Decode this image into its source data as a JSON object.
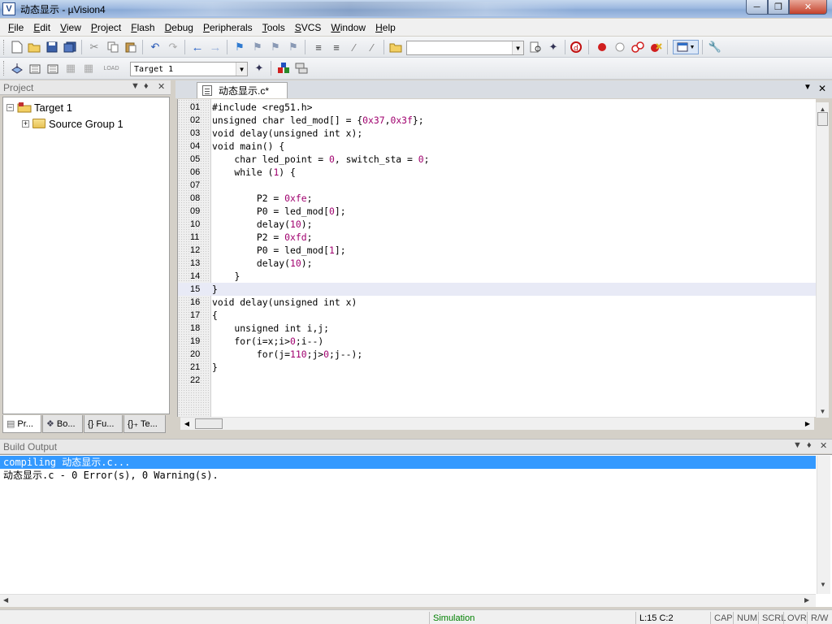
{
  "window": {
    "title": "动态显示 - µVision4",
    "app_icon": "V"
  },
  "menu": [
    "File",
    "Edit",
    "View",
    "Project",
    "Flash",
    "Debug",
    "Peripherals",
    "Tools",
    "SVCS",
    "Window",
    "Help"
  ],
  "toolbar2": {
    "target_value": "Target 1"
  },
  "project_panel": {
    "title": "Project",
    "tree": {
      "root": "Target 1",
      "child": "Source Group 1"
    },
    "tabs": [
      "Pr...",
      "Bo...",
      "{} Fu...",
      "{}₊ Te..."
    ]
  },
  "editor": {
    "tab_label": "动态显示.c*",
    "lines": [
      {
        "n": "01",
        "code": "#include <reg51.h>"
      },
      {
        "n": "02",
        "code": "unsigned char led_mod[] = {0x37,0x3f};"
      },
      {
        "n": "03",
        "code": "void delay(unsigned int x);"
      },
      {
        "n": "04",
        "code": "void main() {"
      },
      {
        "n": "05",
        "code": "    char led_point = 0, switch_sta = 0;"
      },
      {
        "n": "06",
        "code": "    while (1) {"
      },
      {
        "n": "07",
        "code": ""
      },
      {
        "n": "08",
        "code": "        P2 = 0xfe;"
      },
      {
        "n": "09",
        "code": "        P0 = led_mod[0];"
      },
      {
        "n": "10",
        "code": "        delay(10);"
      },
      {
        "n": "11",
        "code": "        P2 = 0xfd;"
      },
      {
        "n": "12",
        "code": "        P0 = led_mod[1];"
      },
      {
        "n": "13",
        "code": "        delay(10);"
      },
      {
        "n": "14",
        "code": "    }"
      },
      {
        "n": "15",
        "code": "}"
      },
      {
        "n": "16",
        "code": "void delay(unsigned int x)"
      },
      {
        "n": "17",
        "code": "{"
      },
      {
        "n": "18",
        "code": "    unsigned int i,j;"
      },
      {
        "n": "19",
        "code": "    for(i=x;i>0;i--)"
      },
      {
        "n": "20",
        "code": "        for(j=110;j>0;j--);"
      },
      {
        "n": "21",
        "code": "}"
      },
      {
        "n": "22",
        "code": ""
      }
    ],
    "highlight_line": "15"
  },
  "build_output": {
    "title": "Build Output",
    "lines": [
      "compiling 动态显示.c...",
      "动态显示.c - 0 Error(s), 0 Warning(s)."
    ]
  },
  "status": {
    "mode": "Simulation",
    "position": "L:15 C:2",
    "caps": "CAP",
    "num": "NUM",
    "scrl": "SCRL",
    "ovr": "OVR",
    "rw": "R/W"
  },
  "colors": {
    "simulation_text": "#008000",
    "number_literal": "#a0006e",
    "selection": "#3399ff",
    "current_line": "#e8eaf6"
  }
}
